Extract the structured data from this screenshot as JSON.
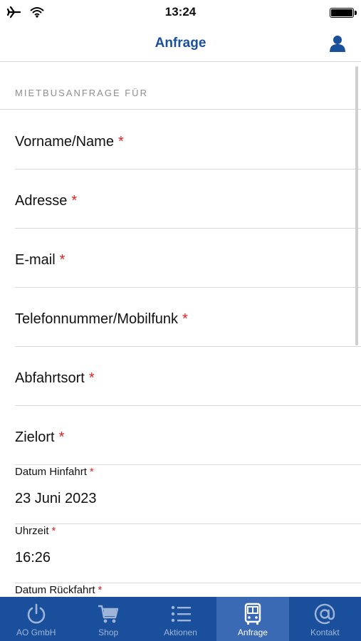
{
  "status": {
    "time": "13:24"
  },
  "nav": {
    "title": "Anfrage"
  },
  "section": {
    "header": "MIETBUSANFRAGE FÜR"
  },
  "form": {
    "required_mark": "*",
    "fields": [
      {
        "label": "Vorname/Name"
      },
      {
        "label": "Adresse"
      },
      {
        "label": "E-mail"
      },
      {
        "label": "Telefonnummer/Mobilfunk"
      },
      {
        "label": "Abfahrtsort"
      },
      {
        "label": "Zielort"
      }
    ],
    "datetime_fields": [
      {
        "label": "Datum Hinfahrt",
        "value": "23 Juni 2023"
      },
      {
        "label": "Uhrzeit",
        "value": "16:26"
      },
      {
        "label": "Datum Rückfahrt",
        "value": ""
      }
    ]
  },
  "tabs": [
    {
      "label": "AO GmbH",
      "icon": "power-icon"
    },
    {
      "label": "Shop",
      "icon": "cart-icon"
    },
    {
      "label": "Aktionen",
      "icon": "list-icon"
    },
    {
      "label": "Anfrage",
      "icon": "bus-icon",
      "active": true
    },
    {
      "label": "Kontakt",
      "icon": "at-icon"
    }
  ],
  "colors": {
    "brand": "#1a4f9c",
    "active_tab": "#3a6ab3",
    "required": "#e02020"
  }
}
